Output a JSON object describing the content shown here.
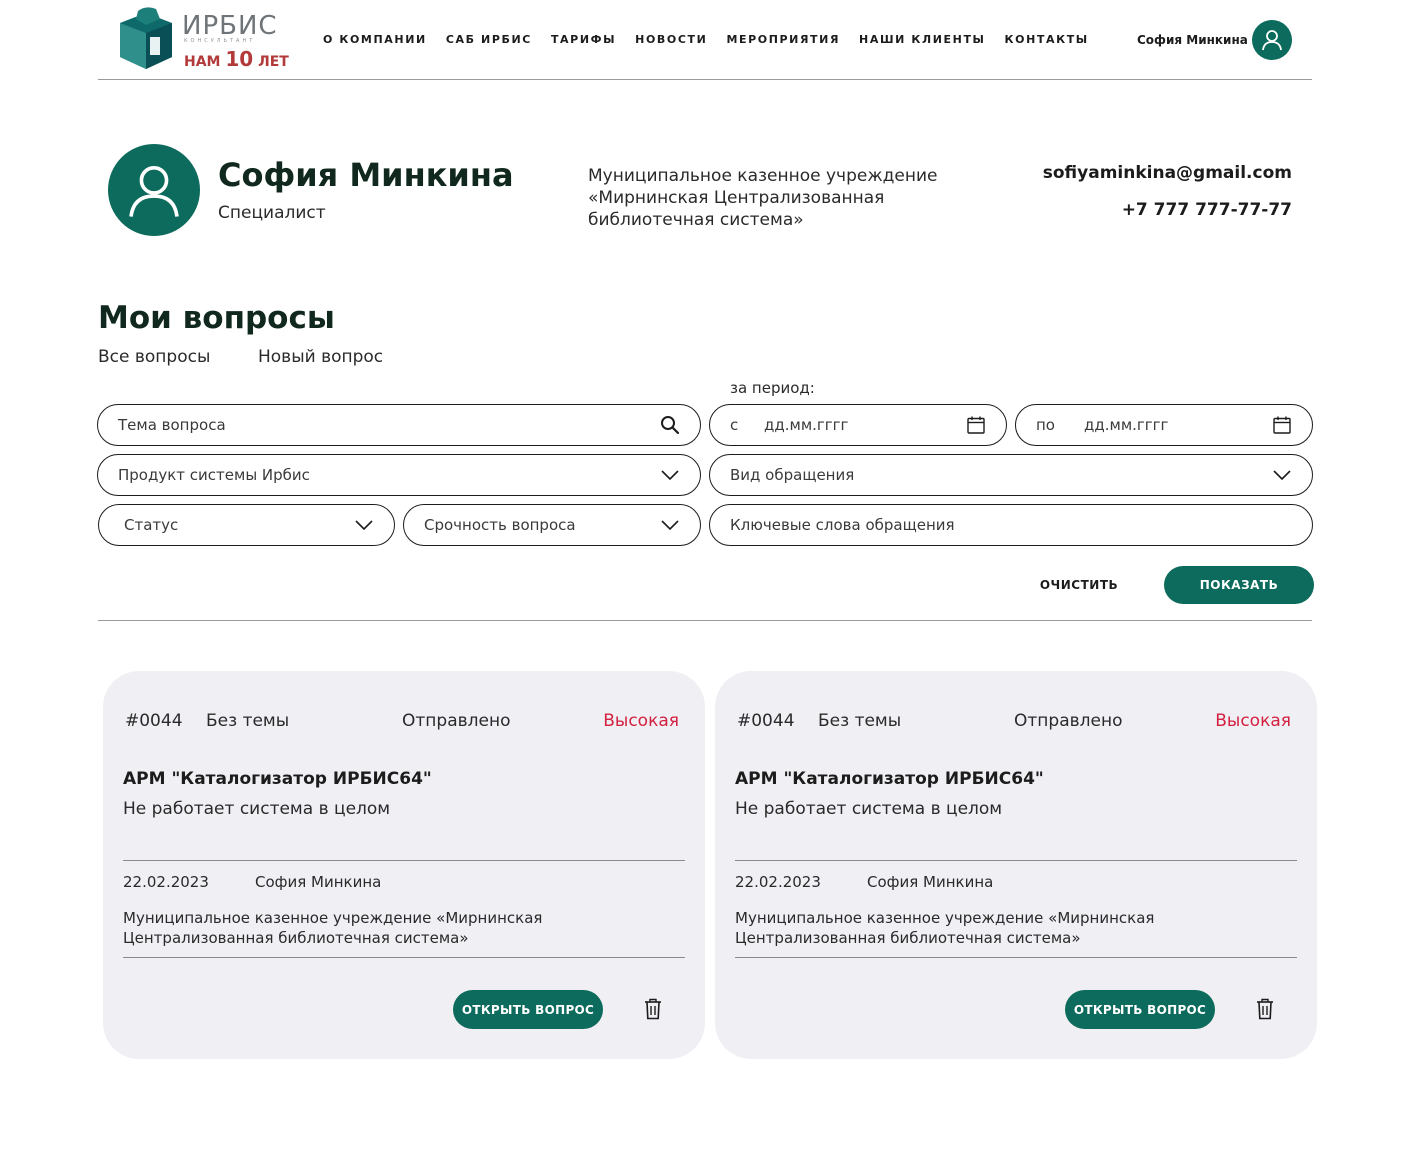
{
  "logo": {
    "name": "ИРБИС",
    "sub": "КОНСУЛЬТАНТ",
    "years_prefix": "НАМ",
    "years_number": "10",
    "years_suffix": "ЛЕТ"
  },
  "nav": [
    "О КОМПАНИИ",
    "САБ ИРБИС",
    "ТАРИФЫ",
    "НОВОСТИ",
    "МЕРОПРИЯТИЯ",
    "НАШИ КЛИЕНТЫ",
    "КОНТАКТЫ"
  ],
  "header_user": {
    "name": "София Минкина",
    "icon": "user-icon"
  },
  "profile": {
    "name": "София Минкина",
    "role": "Специалист",
    "organization": "Муниципальное казенное учреждение «Мирнинская Централизованная библиотечная система»",
    "email": "sofiyaminkina@gmail.com",
    "phone": "+7 777 777-77-77"
  },
  "section": {
    "title": "Мои вопросы",
    "tabs": [
      "Все вопросы",
      "Новый вопрос"
    ]
  },
  "filters": {
    "period_label": "за период:",
    "topic_placeholder": "Тема вопроса",
    "date_from_prefix": "с",
    "date_from_placeholder": "дд.мм.гггг",
    "date_to_prefix": "по",
    "date_to_placeholder": "дд.мм.гггг",
    "product_placeholder": "Продукт системы Ирбис",
    "request_type_placeholder": "Вид обращения",
    "status_placeholder": "Статус",
    "urgency_placeholder": "Срочность вопроса",
    "keywords_placeholder": "Ключевые слова обращения",
    "clear_label": "ОЧИСТИТЬ",
    "show_label": "ПОКАЗАТЬ"
  },
  "cards": [
    {
      "number": "#0044",
      "topic": "Без темы",
      "status": "Отправлено",
      "priority": "Высокая",
      "product": "АРМ \"Каталогизатор ИРБИС64\"",
      "description": "Не работает система в целом",
      "date": "22.02.2023",
      "author": "София Минкина",
      "organization": "Муниципальное казенное учреждение «Мирнинская Централизованная библиотечная система»",
      "open_label": "ОТКРЫТЬ ВОПРОС"
    },
    {
      "number": "#0044",
      "topic": "Без темы",
      "status": "Отправлено",
      "priority": "Высокая",
      "product": "АРМ \"Каталогизатор ИРБИС64\"",
      "description": "Не работает система в целом",
      "date": "22.02.2023",
      "author": "София Минкина",
      "organization": "Муниципальное казенное учреждение «Мирнинская Централизованная библиотечная система»",
      "open_label": "ОТКРЫТЬ ВОПРОС"
    }
  ],
  "colors": {
    "accent": "#0c6b5c",
    "priority_high": "#d32040",
    "card_bg": "#f0eff4"
  }
}
